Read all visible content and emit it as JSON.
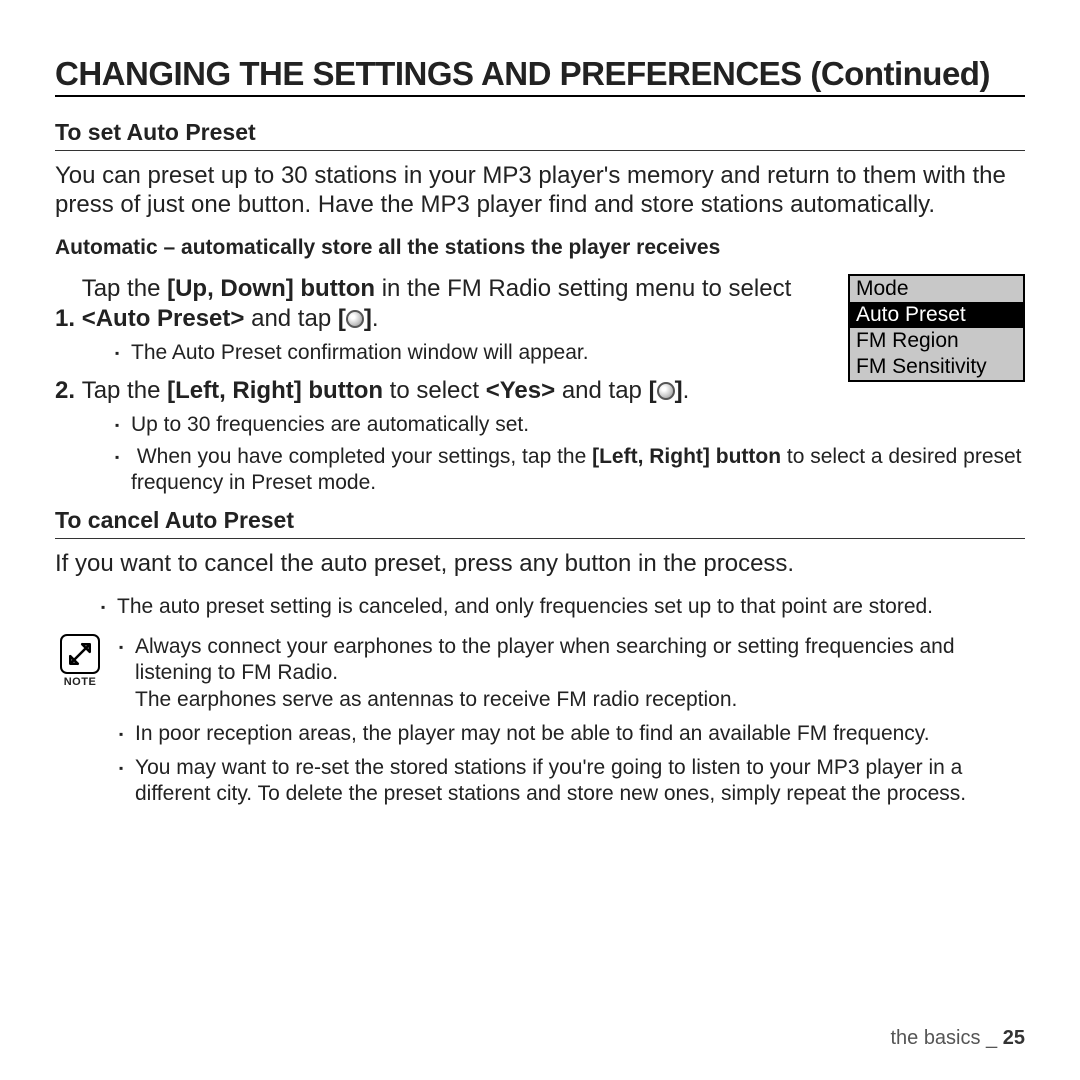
{
  "title": "CHANGING THE SETTINGS AND PREFERENCES (Continued)",
  "section1": {
    "heading": "To set Auto Preset",
    "intro": "You can preset up to 30 stations in your MP3 player's memory and return to them with the press of just one button. Have the MP3 player find and store stations automatically.",
    "automatic_line": "Automatic – automatically store all the stations the player receives",
    "step1_a": "Tap the ",
    "step1_b": "[Up, Down] button",
    "step1_c": " in the FM Radio setting menu to select ",
    "step1_d": "<Auto Preset>",
    "step1_e": " and tap ",
    "step1_sub": "The Auto Preset confirmation window will appear.",
    "step2_a": "Tap the ",
    "step2_b": "[Left, Right] button",
    "step2_c": " to select ",
    "step2_d": "<Yes>",
    "step2_e": " and tap ",
    "step2_sub1": "Up to 30 frequencies are automatically set.",
    "step2_sub2_a": "When you have completed your settings, tap the ",
    "step2_sub2_b": "[Left, Right] button",
    "step2_sub2_c": " to select a desired preset frequency in Preset mode."
  },
  "menu": {
    "items": [
      "Mode",
      "Auto Preset",
      "FM Region",
      "FM Sensitivity"
    ],
    "selected_index": 1
  },
  "section2": {
    "heading": "To cancel Auto Preset",
    "intro": "If you want to cancel the auto preset, press any button in the process.",
    "sub": "The auto preset setting is canceled, and only frequencies set up to that point are stored."
  },
  "note": {
    "label": "NOTE",
    "items": [
      "Always connect your earphones to the player when searching or setting frequencies and listening to FM Radio.\nThe earphones serve as antennas to receive FM radio reception.",
      "In poor reception areas, the player may not be able to find an available FM frequency.",
      "You may want to re-set the stored stations if you're going to listen to your MP3 player in a different city. To delete the preset stations and store new ones, simply repeat the process."
    ]
  },
  "footer": {
    "section": "the basics _ ",
    "page": "25"
  }
}
